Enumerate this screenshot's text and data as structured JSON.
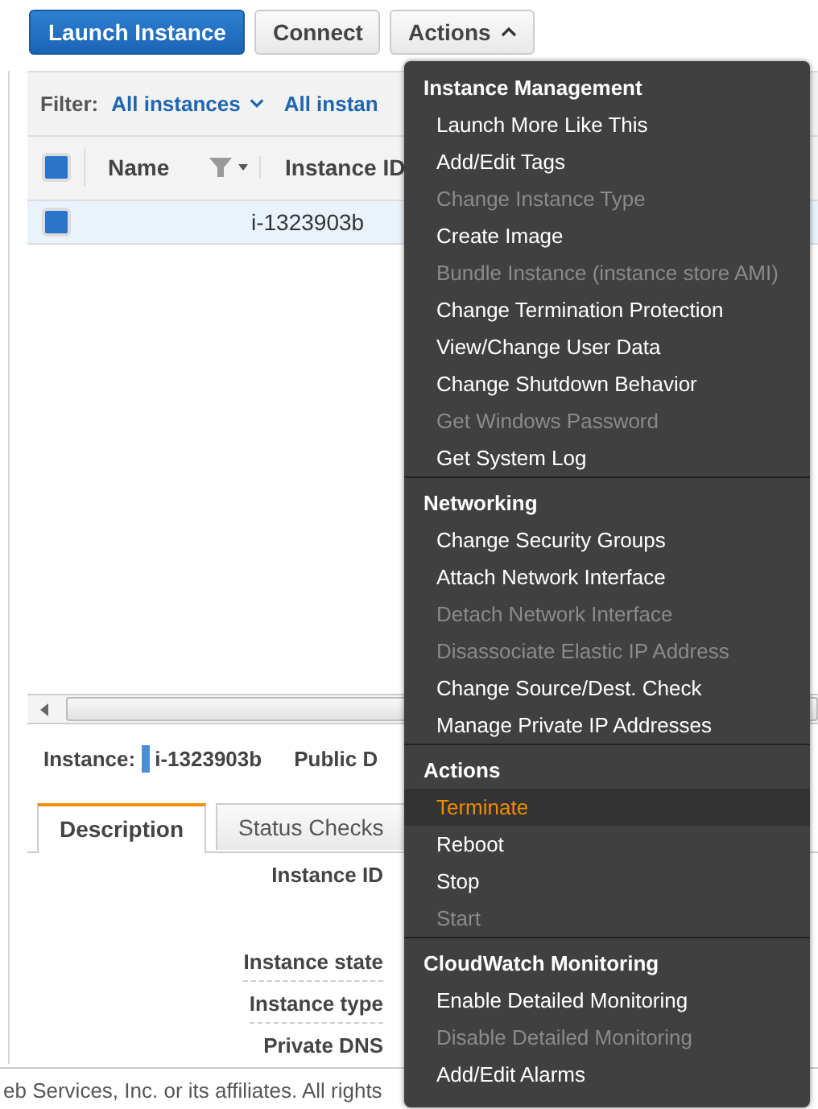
{
  "toolbar": {
    "buttons": [
      {
        "label": "Launch Instance",
        "kind": "primary"
      },
      {
        "label": "Connect",
        "kind": "default"
      },
      {
        "label": "Actions",
        "kind": "menu",
        "expanded": true
      }
    ]
  },
  "filter": {
    "label": "Filter:",
    "options": [
      {
        "label": "All instances"
      },
      {
        "label": "All instan"
      }
    ]
  },
  "table": {
    "all_checked": true,
    "columns": [
      "Name",
      "Instance ID"
    ],
    "rows": [
      {
        "selected": true,
        "checked": true,
        "cells": [
          "",
          "i-1323903b"
        ]
      }
    ]
  },
  "detail": {
    "label": "Instance:",
    "instance_id": "i-1323903b",
    "public_label": "Public D",
    "tabs": [
      {
        "label": "Description",
        "selected": true
      },
      {
        "label": "Status Checks",
        "selected": false
      }
    ],
    "fields": [
      "Instance ID",
      "Instance state",
      "Instance type",
      "Private DNS"
    ]
  },
  "footer": "eb Services, Inc. or its affiliates. All rights",
  "actions_menu": [
    {
      "header": "Instance Management",
      "items": [
        {
          "label": "Launch More Like This",
          "disabled": false,
          "selected": false
        },
        {
          "label": "Add/Edit Tags",
          "disabled": false,
          "selected": false
        },
        {
          "label": "Change Instance Type",
          "disabled": true,
          "selected": false
        },
        {
          "label": "Create Image",
          "disabled": false,
          "selected": false
        },
        {
          "label": "Bundle Instance (instance store AMI)",
          "disabled": true,
          "selected": false
        },
        {
          "label": "Change Termination Protection",
          "disabled": false,
          "selected": false
        },
        {
          "label": "View/Change User Data",
          "disabled": false,
          "selected": false
        },
        {
          "label": "Change Shutdown Behavior",
          "disabled": false,
          "selected": false
        },
        {
          "label": "Get Windows Password",
          "disabled": true,
          "selected": false
        },
        {
          "label": "Get System Log",
          "disabled": false,
          "selected": false
        }
      ]
    },
    {
      "header": "Networking",
      "items": [
        {
          "label": "Change Security Groups",
          "disabled": false,
          "selected": false
        },
        {
          "label": "Attach Network Interface",
          "disabled": false,
          "selected": false
        },
        {
          "label": "Detach Network Interface",
          "disabled": true,
          "selected": false
        },
        {
          "label": "Disassociate Elastic IP Address",
          "disabled": true,
          "selected": false
        },
        {
          "label": "Change Source/Dest. Check",
          "disabled": false,
          "selected": false
        },
        {
          "label": "Manage Private IP Addresses",
          "disabled": false,
          "selected": false
        }
      ]
    },
    {
      "header": "Actions",
      "items": [
        {
          "label": "Terminate",
          "disabled": false,
          "selected": true
        },
        {
          "label": "Reboot",
          "disabled": false,
          "selected": false
        },
        {
          "label": "Stop",
          "disabled": false,
          "selected": false
        },
        {
          "label": "Start",
          "disabled": true,
          "selected": false
        }
      ]
    },
    {
      "header": "CloudWatch Monitoring",
      "items": [
        {
          "label": "Enable Detailed Monitoring",
          "disabled": false,
          "selected": false
        },
        {
          "label": "Disable Detailed Monitoring",
          "disabled": true,
          "selected": false
        },
        {
          "label": "Add/Edit Alarms",
          "disabled": false,
          "selected": false
        }
      ]
    }
  ]
}
